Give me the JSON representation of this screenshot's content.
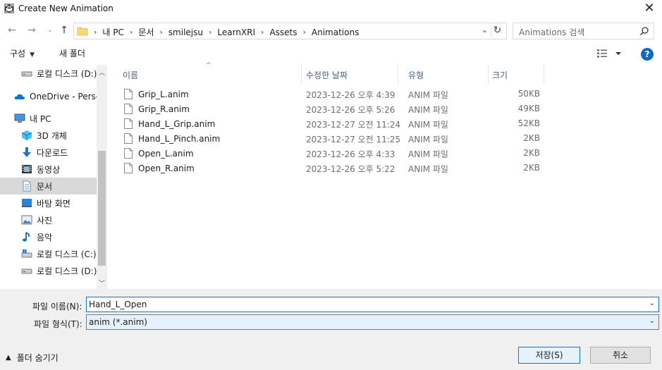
{
  "window": {
    "title": "Create New Animation"
  },
  "nav": {
    "breadcrumbs": [
      "내 PC",
      "문서",
      "smilejsu",
      "LearnXRI",
      "Assets",
      "Animations"
    ],
    "search_placeholder": "Animations 검색"
  },
  "toolbar": {
    "organize_label": "구성",
    "new_folder_label": "새 폴더"
  },
  "sidebar": {
    "items": [
      {
        "label": "로컬 디스크 (D:)",
        "icon": "drive-icon"
      },
      {
        "label": "OneDrive - Personal",
        "icon": "onedrive-icon"
      },
      {
        "label": "내 PC",
        "icon": "pc-icon"
      },
      {
        "label": "3D 개체",
        "icon": "3d-objects-icon"
      },
      {
        "label": "다운로드",
        "icon": "download-icon"
      },
      {
        "label": "동영상",
        "icon": "video-icon"
      },
      {
        "label": "문서",
        "icon": "documents-icon",
        "selected": true
      },
      {
        "label": "바탕 화면",
        "icon": "desktop-icon"
      },
      {
        "label": "사진",
        "icon": "pictures-icon"
      },
      {
        "label": "음악",
        "icon": "music-icon"
      },
      {
        "label": "로컬 디스크 (C:)",
        "icon": "drive-icon"
      },
      {
        "label": "로컬 디스크 (D:)",
        "icon": "drive-icon"
      }
    ]
  },
  "files": {
    "columns": [
      "이름",
      "수정한 날짜",
      "유형",
      "크기"
    ],
    "rows": [
      {
        "name": "Grip_L.anim",
        "date": "2023-12-26 오후 4:39",
        "type": "ANIM 파일",
        "size": "50KB"
      },
      {
        "name": "Grip_R.anim",
        "date": "2023-12-26 오후 5:26",
        "type": "ANIM 파일",
        "size": "49KB"
      },
      {
        "name": "Hand_L_Grip.anim",
        "date": "2023-12-27 오전 11:24",
        "type": "ANIM 파일",
        "size": "52KB"
      },
      {
        "name": "Hand_L_Pinch.anim",
        "date": "2023-12-27 오전 11:25",
        "type": "ANIM 파일",
        "size": "2KB"
      },
      {
        "name": "Open_L.anim",
        "date": "2023-12-26 오후 4:33",
        "type": "ANIM 파일",
        "size": "2KB"
      },
      {
        "name": "Open_R.anim",
        "date": "2023-12-26 오후 5:22",
        "type": "ANIM 파일",
        "size": "2KB"
      }
    ]
  },
  "bottom": {
    "filename_label": "파일 이름(N):",
    "filename_value": "Hand_L_Open",
    "filetype_label": "파일 형식(T):",
    "filetype_value": "anim (*.anim)",
    "hide_folders_label": "폴더 숨기기",
    "save_label": "저장(S)",
    "cancel_label": "취소"
  },
  "colors": {
    "accent": "#0078d7",
    "selected_bg": "#d9d9d9",
    "help_blue": "#0f6cbd"
  }
}
